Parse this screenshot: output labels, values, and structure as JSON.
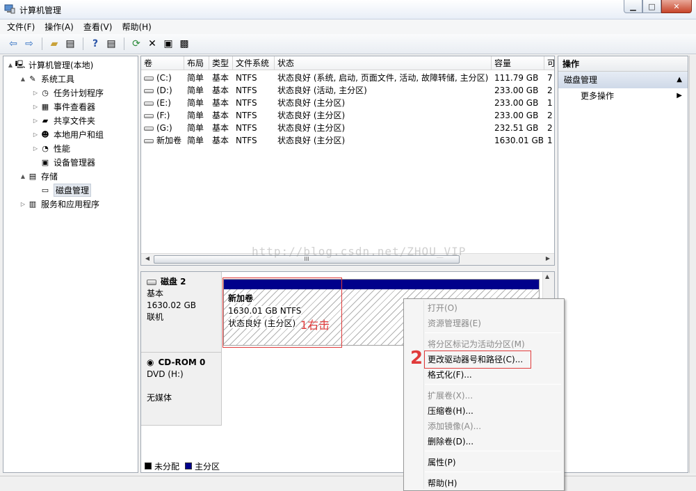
{
  "window": {
    "title": "计算机管理"
  },
  "menu": [
    "文件(F)",
    "操作(A)",
    "查看(V)",
    "帮助(H)"
  ],
  "tree": [
    {
      "label": "计算机管理(本地)",
      "level": 0,
      "arrow": "▲",
      "icon": "computer-icon"
    },
    {
      "label": "系统工具",
      "level": 1,
      "arrow": "▲",
      "icon": "tools-icon"
    },
    {
      "label": "任务计划程序",
      "level": 2,
      "arrow": "▷",
      "icon": "clock-icon"
    },
    {
      "label": "事件查看器",
      "level": 2,
      "arrow": "▷",
      "icon": "event-icon"
    },
    {
      "label": "共享文件夹",
      "level": 2,
      "arrow": "▷",
      "icon": "folder-icon"
    },
    {
      "label": "本地用户和组",
      "level": 2,
      "arrow": "▷",
      "icon": "users-icon"
    },
    {
      "label": "性能",
      "level": 2,
      "arrow": "▷",
      "icon": "performance-icon"
    },
    {
      "label": "设备管理器",
      "level": 2,
      "arrow": "",
      "icon": "device-icon"
    },
    {
      "label": "存储",
      "level": 1,
      "arrow": "▲",
      "icon": "storage-icon"
    },
    {
      "label": "磁盘管理",
      "level": 2,
      "arrow": "",
      "icon": "disk-icon",
      "selected": true
    },
    {
      "label": "服务和应用程序",
      "level": 1,
      "arrow": "▷",
      "icon": "services-icon"
    }
  ],
  "volume_table": {
    "headers": [
      "卷",
      "布局",
      "类型",
      "文件系统",
      "状态",
      "容量",
      "可"
    ],
    "rows": [
      [
        "(C:)",
        "简单",
        "基本",
        "NTFS",
        "状态良好 (系统, 启动, 页面文件, 活动, 故障转储, 主分区)",
        "111.79 GB",
        "7"
      ],
      [
        "(D:)",
        "简单",
        "基本",
        "NTFS",
        "状态良好 (活动, 主分区)",
        "233.00 GB",
        "2"
      ],
      [
        "(E:)",
        "简单",
        "基本",
        "NTFS",
        "状态良好 (主分区)",
        "233.00 GB",
        "1"
      ],
      [
        "(F:)",
        "简单",
        "基本",
        "NTFS",
        "状态良好 (主分区)",
        "233.00 GB",
        "2"
      ],
      [
        "(G:)",
        "简单",
        "基本",
        "NTFS",
        "状态良好 (主分区)",
        "232.51 GB",
        "2"
      ],
      [
        "新加卷",
        "简单",
        "基本",
        "NTFS",
        "状态良好 (主分区)",
        "1630.01 GB",
        "1"
      ]
    ]
  },
  "watermark": "http://blog.csdn.net/ZHOU_VIP",
  "hscroll_grip": "III",
  "disk2": {
    "name": "磁盘 2",
    "type": "基本",
    "size": "1630.02 GB",
    "state": "联机",
    "volume": {
      "name": "新加卷",
      "size": "1630.01 GB NTFS",
      "status": "状态良好 (主分区)"
    }
  },
  "cdrom": {
    "name": "CD-ROM 0",
    "drive": "DVD (H:)",
    "media": "无媒体"
  },
  "legend": [
    {
      "label": "未分配",
      "color": "#000000"
    },
    {
      "label": "主分区",
      "color": "#00008b"
    }
  ],
  "actions": {
    "header": "操作",
    "section": "磁盘管理",
    "more": "更多操作"
  },
  "context_menu": [
    {
      "label": "打开(O)",
      "disabled": true
    },
    {
      "label": "资源管理器(E)",
      "disabled": true
    },
    {
      "label": "将分区标记为活动分区(M)",
      "disabled": true
    },
    {
      "label": "更改驱动器号和路径(C)...",
      "disabled": false
    },
    {
      "label": "格式化(F)...",
      "disabled": false
    },
    {
      "label": "扩展卷(X)...",
      "disabled": true
    },
    {
      "label": "压缩卷(H)...",
      "disabled": false
    },
    {
      "label": "添加镜像(A)...",
      "disabled": true
    },
    {
      "label": "删除卷(D)...",
      "disabled": false
    },
    {
      "label": "属性(P)",
      "disabled": false
    },
    {
      "label": "帮助(H)",
      "disabled": false
    }
  ],
  "annotations": {
    "step1": "1右击",
    "step2": "2"
  },
  "colors": {
    "primary_partition": "#00008b",
    "annotation": "#e03a3a"
  }
}
